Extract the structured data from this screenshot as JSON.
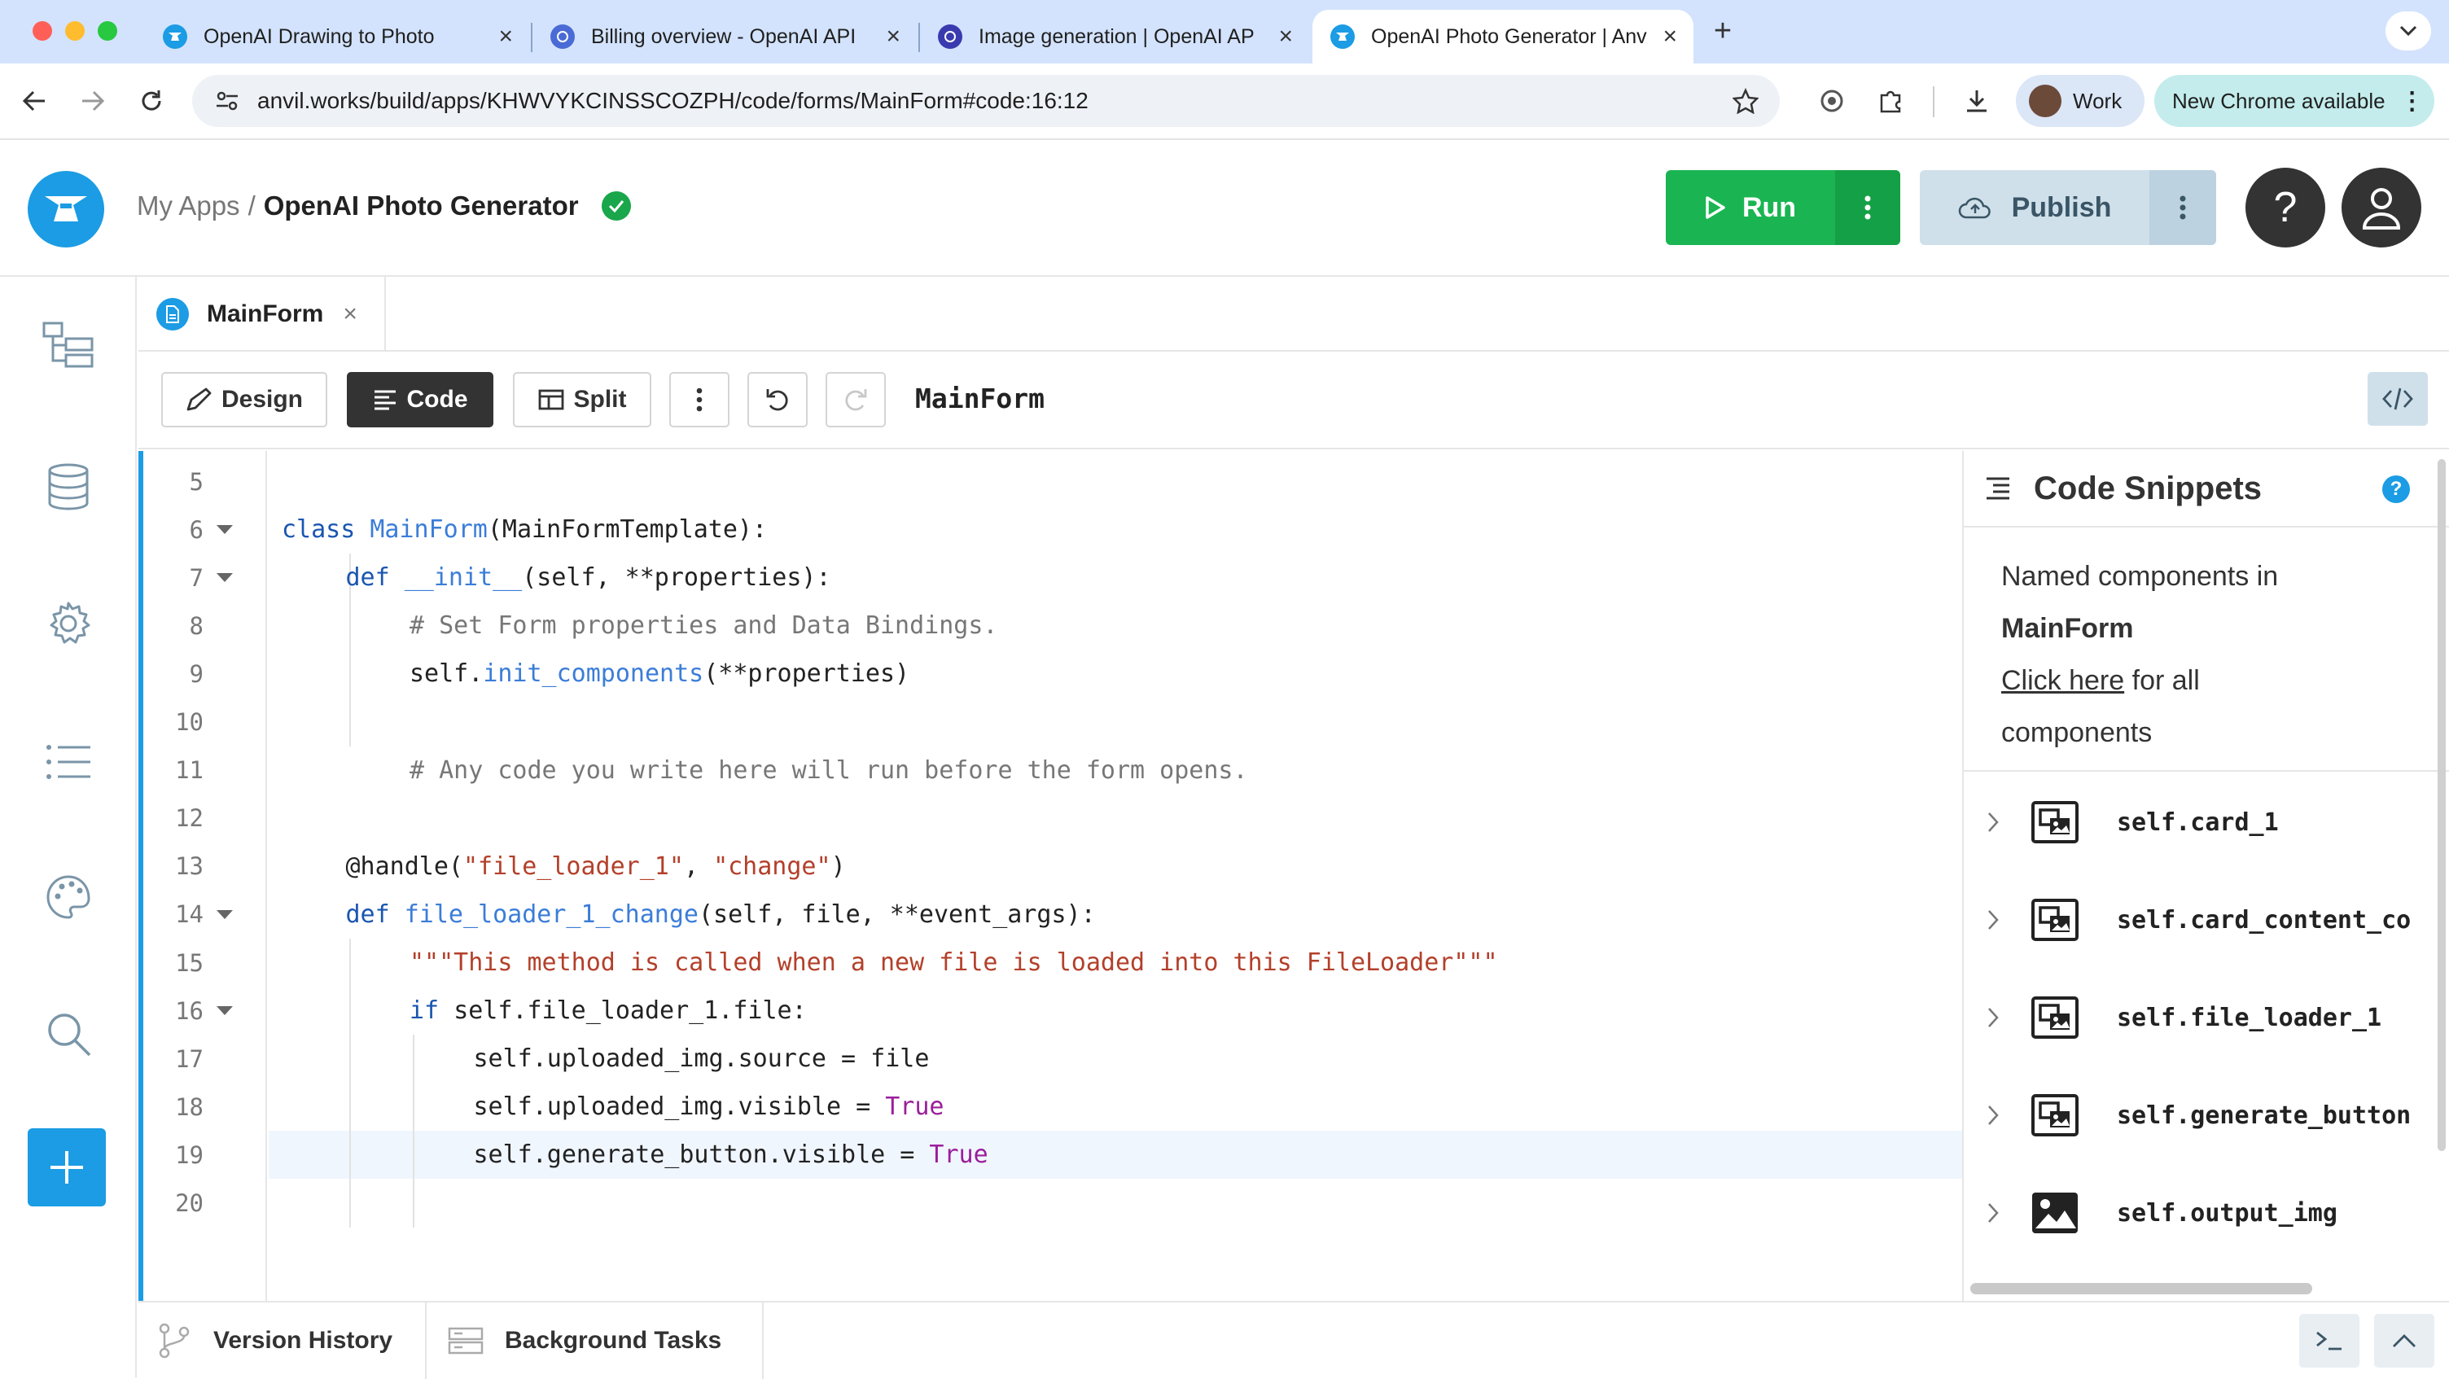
{
  "browser": {
    "tabs": [
      {
        "title": "OpenAI Drawing to Photo",
        "active": false
      },
      {
        "title": "Billing overview - OpenAI API",
        "active": false
      },
      {
        "title": "Image generation | OpenAI AP",
        "active": false
      },
      {
        "title": "OpenAI Photo Generator | Anv",
        "active": true
      }
    ],
    "url": "anvil.works/build/apps/KHWVYKCINSSCOZPH/code/forms/MainForm#code:16:12",
    "profile_label": "Work",
    "update_label": "New Chrome available"
  },
  "header": {
    "breadcrumb_root": "My Apps",
    "separator": "/",
    "app_name": "OpenAI Photo Generator",
    "run_label": "Run",
    "publish_label": "Publish",
    "help_label": "?"
  },
  "file_tab": {
    "label": "MainForm"
  },
  "editor_toolbar": {
    "design_label": "Design",
    "code_label": "Code",
    "split_label": "Split",
    "form_name": "MainForm"
  },
  "code": {
    "active_line": 19,
    "lines": [
      {
        "n": "5",
        "indent": 0,
        "fold": false,
        "tokens": []
      },
      {
        "n": "6",
        "indent": 0,
        "fold": true,
        "tokens": [
          [
            "kw",
            "class "
          ],
          [
            "cls",
            "MainForm"
          ],
          [
            "",
            "(MainFormTemplate):"
          ]
        ]
      },
      {
        "n": "7",
        "indent": 1,
        "fold": true,
        "tokens": [
          [
            "kw",
            "def "
          ],
          [
            "fn",
            "__init__"
          ],
          [
            "",
            "(self, **properties):"
          ]
        ]
      },
      {
        "n": "8",
        "indent": 2,
        "fold": false,
        "tokens": [
          [
            "cmt",
            "# Set Form properties and Data Bindings."
          ]
        ]
      },
      {
        "n": "9",
        "indent": 2,
        "fold": false,
        "tokens": [
          [
            "",
            "self."
          ],
          [
            "fn",
            "init_components"
          ],
          [
            "",
            "(**properties)"
          ]
        ]
      },
      {
        "n": "10",
        "indent": 0,
        "fold": false,
        "tokens": []
      },
      {
        "n": "11",
        "indent": 2,
        "fold": false,
        "tokens": [
          [
            "cmt",
            "# Any code you write here will run before the form opens."
          ]
        ]
      },
      {
        "n": "12",
        "indent": 0,
        "fold": false,
        "tokens": []
      },
      {
        "n": "13",
        "indent": 1,
        "fold": false,
        "tokens": [
          [
            "",
            "@handle("
          ],
          [
            "str",
            "\"file_loader_1\""
          ],
          [
            "",
            ", "
          ],
          [
            "str",
            "\"change\""
          ],
          [
            "",
            ")"
          ]
        ]
      },
      {
        "n": "14",
        "indent": 1,
        "fold": true,
        "tokens": [
          [
            "kw",
            "def "
          ],
          [
            "fn",
            "file_loader_1_change"
          ],
          [
            "",
            "(self, file, **event_args):"
          ]
        ]
      },
      {
        "n": "15",
        "indent": 2,
        "fold": false,
        "tokens": [
          [
            "str",
            "\"\"\"This method is called when a new file is loaded into this FileLoader\"\"\""
          ]
        ]
      },
      {
        "n": "16",
        "indent": 2,
        "fold": true,
        "tokens": [
          [
            "kw",
            "if "
          ],
          [
            "",
            "self.file_loader_1.file:"
          ]
        ]
      },
      {
        "n": "17",
        "indent": 3,
        "fold": false,
        "tokens": [
          [
            "",
            "self.uploaded_img.source = file"
          ]
        ]
      },
      {
        "n": "18",
        "indent": 3,
        "fold": false,
        "tokens": [
          [
            "",
            "self.uploaded_img.visible = "
          ],
          [
            "bool",
            "True"
          ]
        ]
      },
      {
        "n": "19",
        "indent": 3,
        "fold": false,
        "tokens": [
          [
            "",
            "self.generate_button.visible = "
          ],
          [
            "bool",
            "True"
          ]
        ]
      },
      {
        "n": "20",
        "indent": 0,
        "fold": false,
        "tokens": []
      }
    ]
  },
  "snippets": {
    "title": "Code Snippets",
    "help": "?",
    "desc_prefix": "Named components in",
    "desc_form": "MainForm",
    "desc_link": "Click here",
    "desc_suffix": "for all",
    "desc_last": "components",
    "items": [
      {
        "label": "self.card_1",
        "icon": "container-icon"
      },
      {
        "label": "self.card_content_co",
        "icon": "container-icon"
      },
      {
        "label": "self.file_loader_1",
        "icon": "container-icon"
      },
      {
        "label": "self.generate_button",
        "icon": "container-icon"
      },
      {
        "label": "self.output_img",
        "icon": "image-icon"
      }
    ]
  },
  "bottom": {
    "version_history_label": "Version History",
    "background_tasks_label": "Background Tasks"
  },
  "colors": {
    "accent": "#1b9ce4",
    "run_green": "#1ab552",
    "publish_bg": "#cfe0ea",
    "tabbar": "#d3e3fd"
  }
}
